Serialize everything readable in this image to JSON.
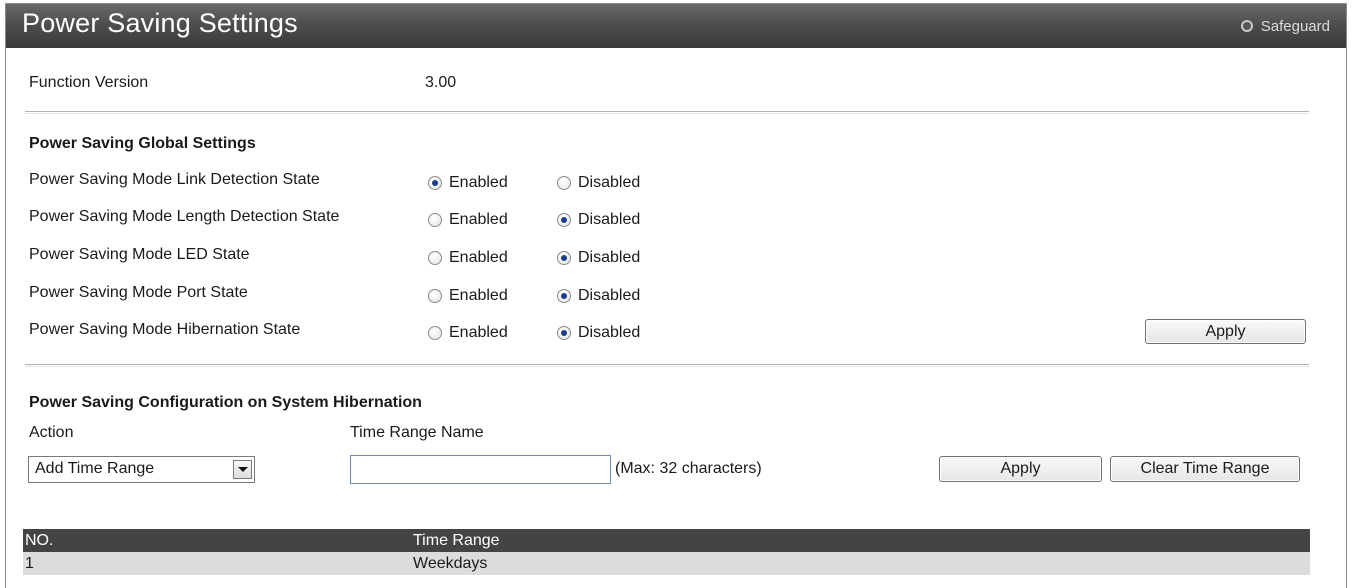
{
  "header": {
    "title": "Power Saving Settings",
    "safeguard_label": "Safeguard"
  },
  "function_version": {
    "label": "Function Version",
    "value": "3.00"
  },
  "global_settings": {
    "heading": "Power Saving Global Settings",
    "enabled_label": "Enabled",
    "disabled_label": "Disabled",
    "rows": [
      {
        "label": "Power Saving Mode Link Detection State",
        "selected": "Enabled"
      },
      {
        "label": "Power Saving Mode Length Detection State",
        "selected": "Disabled"
      },
      {
        "label": "Power Saving Mode LED State",
        "selected": "Disabled"
      },
      {
        "label": "Power Saving Mode Port State",
        "selected": "Disabled"
      },
      {
        "label": "Power Saving Mode Hibernation State",
        "selected": "Disabled"
      }
    ],
    "apply_label": "Apply"
  },
  "hibernation": {
    "heading": "Power Saving Configuration on System Hibernation",
    "action_label": "Action",
    "time_range_name_label": "Time Range Name",
    "action_selected": "Add Time Range",
    "time_range_value": "",
    "max_hint": "(Max: 32 characters)",
    "apply_label": "Apply",
    "clear_label": "Clear Time Range"
  },
  "table": {
    "columns": [
      "NO.",
      "Time Range"
    ],
    "rows": [
      [
        "1",
        "Weekdays"
      ]
    ]
  }
}
